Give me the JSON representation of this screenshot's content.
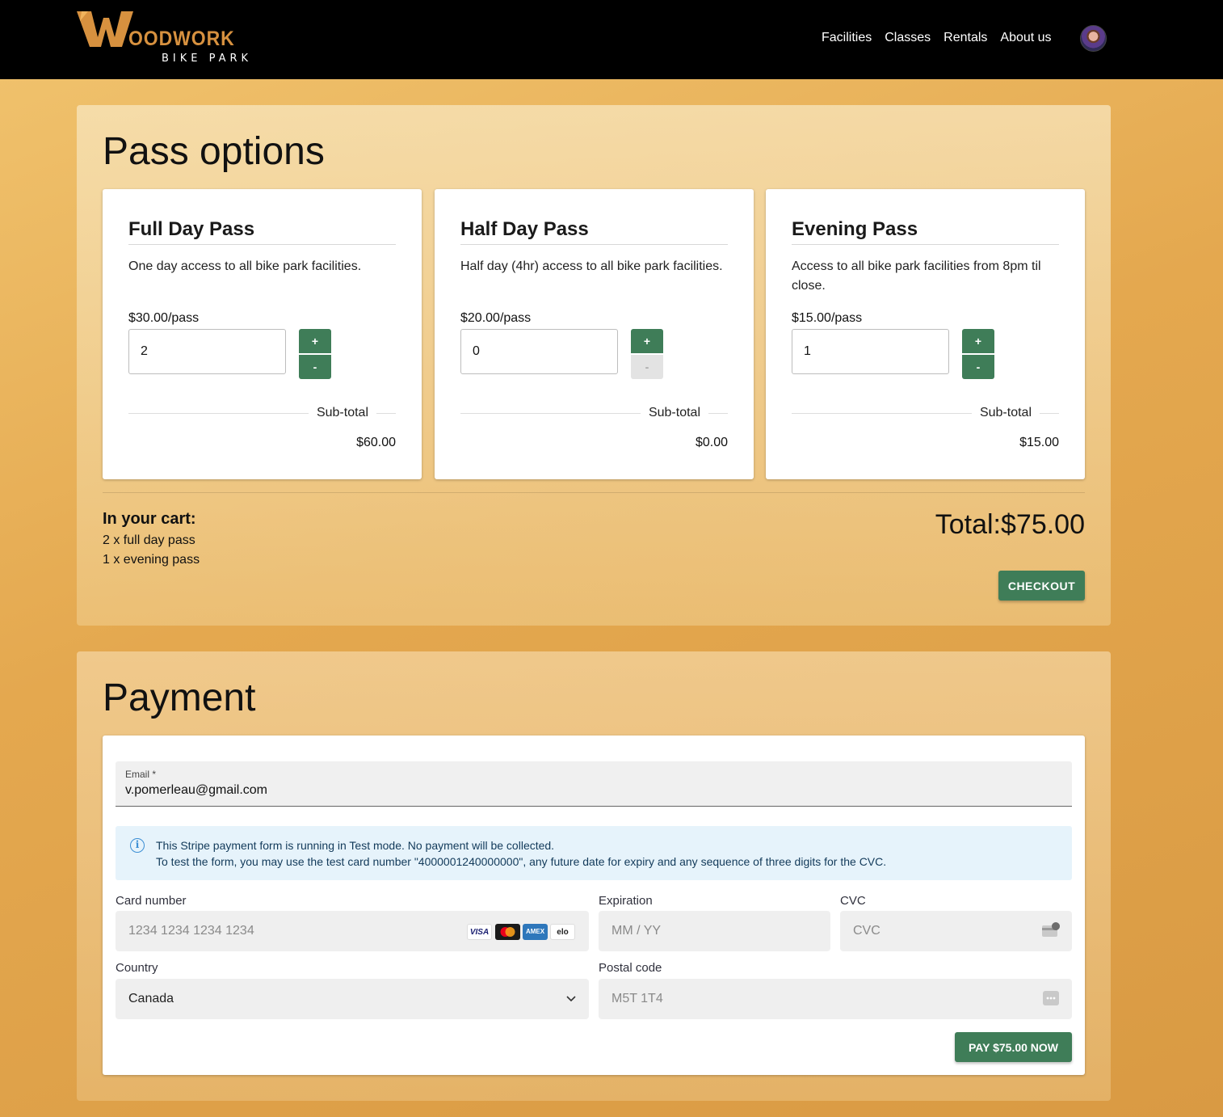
{
  "header": {
    "logo_word": "OODWORK",
    "logo_sub": "BIKE PARK",
    "nav": [
      "Facilities",
      "Classes",
      "Rentals",
      "About us"
    ]
  },
  "pass_options": {
    "title": "Pass options",
    "cards": [
      {
        "name": "Full Day Pass",
        "description": "One day access to all bike park facilities.",
        "price": "$30.00/pass",
        "quantity": "2",
        "plus": "+",
        "minus": "-",
        "minus_disabled": false,
        "subtotal_label": "Sub-total",
        "subtotal": "$60.00"
      },
      {
        "name": "Half Day Pass",
        "description": "Half day (4hr) access to all bike park facilities.",
        "price": "$20.00/pass",
        "quantity": "0",
        "plus": "+",
        "minus": "-",
        "minus_disabled": true,
        "subtotal_label": "Sub-total",
        "subtotal": "$0.00"
      },
      {
        "name": "Evening Pass",
        "description": "Access to all bike park facilities from 8pm til close.",
        "price": "$15.00/pass",
        "quantity": "1",
        "plus": "+",
        "minus": "-",
        "minus_disabled": false,
        "subtotal_label": "Sub-total",
        "subtotal": "$15.00"
      }
    ],
    "cart_title": "In your cart:",
    "cart_items": [
      "2 x full day pass",
      "1 x evening pass"
    ],
    "total": "Total:$75.00",
    "checkout_label": "CHECKOUT"
  },
  "payment": {
    "title": "Payment",
    "email_label": "Email *",
    "email_value": "v.pomerleau@gmail.com",
    "notice_line1": "This Stripe payment form is running in Test mode. No payment will be collected.",
    "notice_line2": "To test the form, you may use the test card number \"4000001240000000\", any future date for expiry and any sequence of three digits for the CVC.",
    "card_number_label": "Card number",
    "card_number_placeholder": "1234 1234 1234 1234",
    "card_brands": [
      "VISA",
      "mastercard",
      "AMEX",
      "elo"
    ],
    "expiration_label": "Expiration",
    "expiration_placeholder": "MM / YY",
    "cvc_label": "CVC",
    "cvc_placeholder": "CVC",
    "country_label": "Country",
    "country_value": "Canada",
    "postal_label": "Postal code",
    "postal_placeholder": "M5T 1T4",
    "pay_label": "PAY $75.00 NOW"
  },
  "colors": {
    "accent_green": "#3f7d58",
    "logo_orange": "#d7913f",
    "header_bg": "#000000"
  }
}
